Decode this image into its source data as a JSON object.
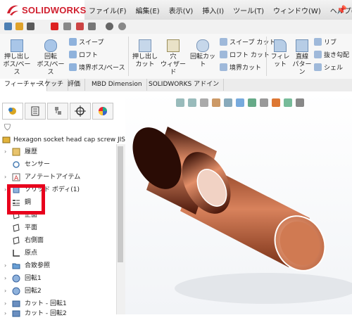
{
  "app": {
    "brand": "SOLIDWORKS"
  },
  "menu": [
    "ファイル(F)",
    "編集(E)",
    "表示(V)",
    "挿入(I)",
    "ツール(T)",
    "ウィンドウ(W)",
    "ヘルプ(H)"
  ],
  "ribbon": {
    "extrude_boss": [
      "押し出し",
      "ボス/ベース"
    ],
    "revolve_boss": [
      "回転",
      "ボス/ベース"
    ],
    "sweep": "スイープ",
    "loft": "ロフト",
    "boundary_boss": "境界ボス/ベース",
    "extrude_cut": [
      "押し出し",
      "カット"
    ],
    "hole_wizard": [
      "穴",
      "ウィザード"
    ],
    "revolve_cut": "回転カット",
    "swept_cut": "スイープ カット",
    "lofted_cut": "ロフト カット",
    "boundary_cut": "境界カット",
    "fillet": "フィレット",
    "linear_pattern": [
      "直線",
      "パターン"
    ],
    "rib": "リブ",
    "draft": "抜き勾配",
    "shell": "シェル"
  },
  "tabs": [
    "フィーチャー",
    "スケッチ",
    "評価",
    "MBD Dimension",
    "SOLIDWORKS アドイン"
  ],
  "tree": {
    "root": "Hexagon socket head cap screw JIS",
    "items": [
      {
        "label": "履歴"
      },
      {
        "label": "センサー"
      },
      {
        "label": "アノテートアイテム"
      },
      {
        "label": "ソリッド ボディ(1)"
      },
      {
        "label": "鋼"
      },
      {
        "label": "正面"
      },
      {
        "label": "平面"
      },
      {
        "label": "右側面"
      },
      {
        "label": "原点"
      },
      {
        "label": "合致参照"
      },
      {
        "label": "回転1"
      },
      {
        "label": "回転2"
      },
      {
        "label": "カット - 回転1"
      },
      {
        "label": "カット - 回転2"
      }
    ]
  },
  "colors": {
    "brand_red": "#d1202f",
    "highlight_red": "#e8001c",
    "copper": "#c8734f"
  }
}
